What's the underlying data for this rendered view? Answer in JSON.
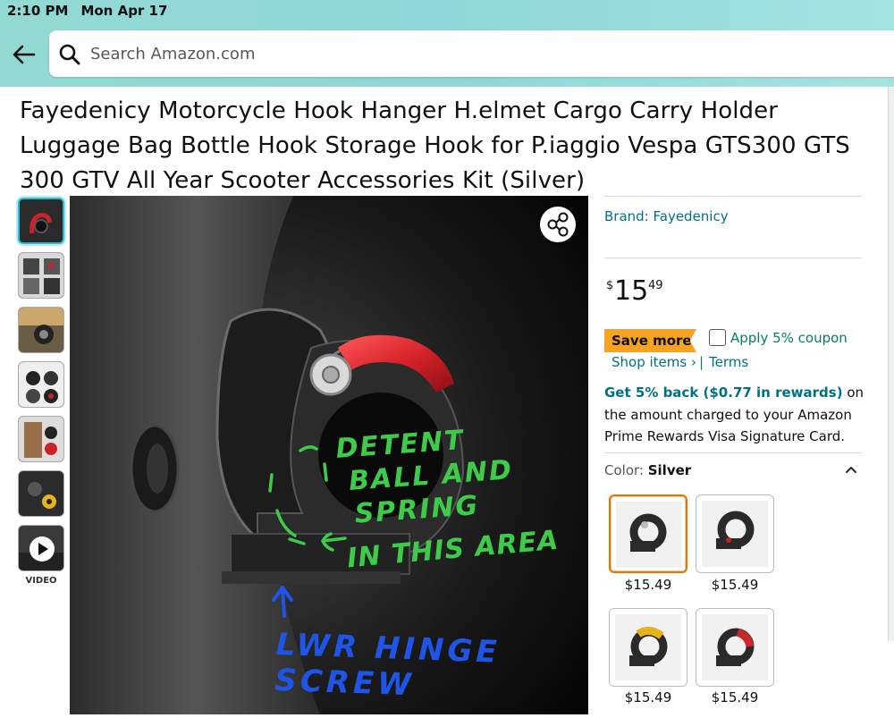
{
  "status_bar": {
    "time": "2:10 PM",
    "date": "Mon Apr 17"
  },
  "search": {
    "placeholder": "Search Amazon.com",
    "value": ""
  },
  "product": {
    "title": "Fayedenicy Motorcycle Hook Hanger H.elmet Cargo Carry Holder Luggage Bag Bottle Hook Storage Hook for P.iaggio Vespa GTS300 GTS 300 GTV All Year Scooter Accessories Kit (Silver)",
    "brand": "Brand: Fayedenicy",
    "price": {
      "symbol": "$",
      "whole": "15",
      "fraction": "49"
    },
    "save_badge": "Save more",
    "coupon": "Apply 5% coupon",
    "coupon_checked": false,
    "shop_items": "Shop items ›",
    "separator": "|",
    "terms": "Terms",
    "rewards_highlight": "Get 5% back ($0.77 in rewards)",
    "rewards_rest": " on the amount charged to your Amazon Prime Rewards Visa Signature Card.",
    "color_label": "Color: ",
    "color_value": "Silver"
  },
  "thumbnails": [
    {
      "icon": "product-image"
    },
    {
      "icon": "product-image"
    },
    {
      "icon": "product-image"
    },
    {
      "icon": "product-image"
    },
    {
      "icon": "product-image"
    },
    {
      "icon": "product-image"
    },
    {
      "icon": "play-icon",
      "label": "VIDEO"
    }
  ],
  "annotations": {
    "detent": [
      "DETENT",
      "BALL AND",
      "SPRING",
      "IN THIS AREA"
    ],
    "hinge": "LWR HINGE SCREW"
  },
  "swatches": [
    {
      "price": "$15.49",
      "accent": "#2a2a2a",
      "selected": true
    },
    {
      "price": "$15.49",
      "accent": "#2a2a2a",
      "selected": false
    },
    {
      "price": "$15.49",
      "accent": "#e8b21c",
      "selected": false
    },
    {
      "price": "$15.49",
      "accent": "#c8282a",
      "selected": false
    }
  ],
  "colors": {
    "teal_header": "#93d9d3",
    "link": "#007185",
    "green": "#067d62",
    "badge": "#f6a324",
    "annotation_green": "#3ecb4a",
    "annotation_blue": "#1e55e8",
    "hook_red": "#d8232a"
  }
}
